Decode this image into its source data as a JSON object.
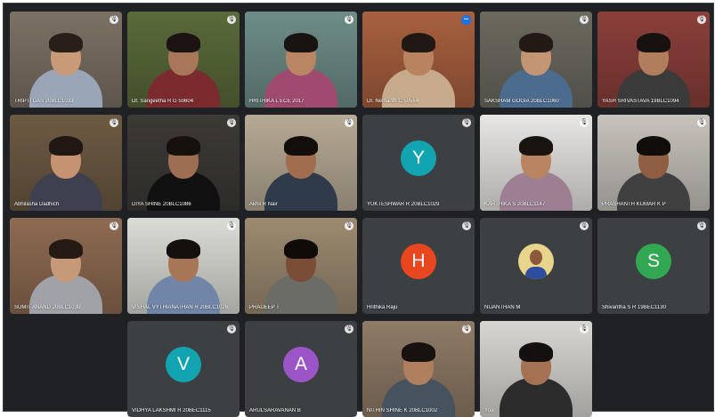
{
  "meeting": {
    "participants": [
      {
        "name": "TRIPTI DAS 20BLC1033",
        "type": "video",
        "skin": "#c89a78",
        "hair": "#2a1f18",
        "shirt": "#9aa5b8",
        "bg": "#7c7165"
      },
      {
        "name": "Dr. Sangeetha R G 50604",
        "type": "video",
        "skin": "#a8775a",
        "hair": "#1b1412",
        "shirt": "#7b2a2e",
        "bg": "#5a6a3a"
      },
      {
        "name": "HRITHIKA L ECE 2017",
        "type": "video",
        "skin": "#b98563",
        "hair": "#191412",
        "shirt": "#a04a6f",
        "bg": "#6e8d87"
      },
      {
        "name": "Dr. Nemanth C 50564",
        "type": "video",
        "skin": "#b8835e",
        "hair": "#1f1814",
        "shirt": "#c7a98b",
        "bg": "#a8603f",
        "speaking": true
      },
      {
        "name": "SAKSHAM GOGIA 20BLC1060",
        "type": "video",
        "skin": "#c49575",
        "hair": "#241a15",
        "shirt": "#4b6b8f",
        "bg": "#6c6a5f"
      },
      {
        "name": "YASH SRIVASTAVA 19BLC1094",
        "type": "video",
        "skin": "#b07e5c",
        "hair": "#171210",
        "shirt": "#3b3b3b",
        "bg": "#8b3f3a"
      },
      {
        "name": "Abhilasha Dadhich",
        "type": "video",
        "skin": "#c59371",
        "hair": "#201814",
        "shirt": "#3e3f4f",
        "bg": "#6d5a43"
      },
      {
        "name": "DIYA SHINE 20BLC1086",
        "type": "video",
        "skin": "#9e6e52",
        "hair": "#17110e",
        "shirt": "#111111",
        "bg": "#3d3a36"
      },
      {
        "name": "Akhil R Nair",
        "type": "video",
        "skin": "#a06d4e",
        "hair": "#120e0c",
        "shirt": "#2f3b4a",
        "bg": "#b6aa94"
      },
      {
        "name": "YUKTESHWAR R 20BLC1029",
        "type": "avatar",
        "letter": "Y",
        "color": "#12a4b0"
      },
      {
        "name": "KARTHIKA S 20BLC1147",
        "type": "video",
        "skin": "#b88461",
        "hair": "#1a1411",
        "shirt": "#9c7f92",
        "bg": "#e8e6e4"
      },
      {
        "name": "PRASHANTH KUMAR K P",
        "type": "video",
        "skin": "#8f5e41",
        "hair": "#110d0a",
        "shirt": "#404040",
        "bg": "#c7c2bb"
      },
      {
        "name": "SUMIT ANAND 20BLC1030",
        "type": "video",
        "skin": "#c69a78",
        "hair": "#251a14",
        "shirt": "#a0a2a8",
        "bg": "#8e6b52"
      },
      {
        "name": "VISHAL VYTHIANATHAN R 20BLC1026",
        "type": "video",
        "skin": "#a77656",
        "hair": "#15100d",
        "shirt": "#6f86a9",
        "bg": "#dcdcd6"
      },
      {
        "name": "PRADEEP T",
        "type": "video",
        "skin": "#7a4e36",
        "hair": "#0f0b09",
        "shirt": "#6c6c66",
        "bg": "#9c8a70"
      },
      {
        "name": "Hrithika Raju",
        "type": "avatar",
        "letter": "H",
        "color": "#e8461e"
      },
      {
        "name": "NIJANTHAN M",
        "type": "avatar-photo",
        "skin": "#8b5a3c",
        "shirt": "#2d4ea0",
        "bg": "#e8d48a"
      },
      {
        "name": "Shivaritha S R 19BEC1130",
        "type": "avatar",
        "letter": "S",
        "color": "#33a852"
      },
      {
        "name": "VIDHYA LAKSHMI R 20BEC1115",
        "type": "avatar",
        "letter": "V",
        "color": "#12a4b0"
      },
      {
        "name": "ARULSARAVANAN B",
        "type": "avatar",
        "letter": "A",
        "color": "#9b55c6"
      },
      {
        "name": "NITHIN SHINE K 20BLC1002",
        "type": "video",
        "skin": "#b07f5f",
        "hair": "#171210",
        "shirt": "#46535f",
        "bg": "#8f7b66"
      },
      {
        "name": "You",
        "type": "video",
        "skin": "#a47253",
        "hair": "#141010",
        "shirt": "#2c2c2c",
        "bg": "#d8d6d2"
      }
    ]
  }
}
